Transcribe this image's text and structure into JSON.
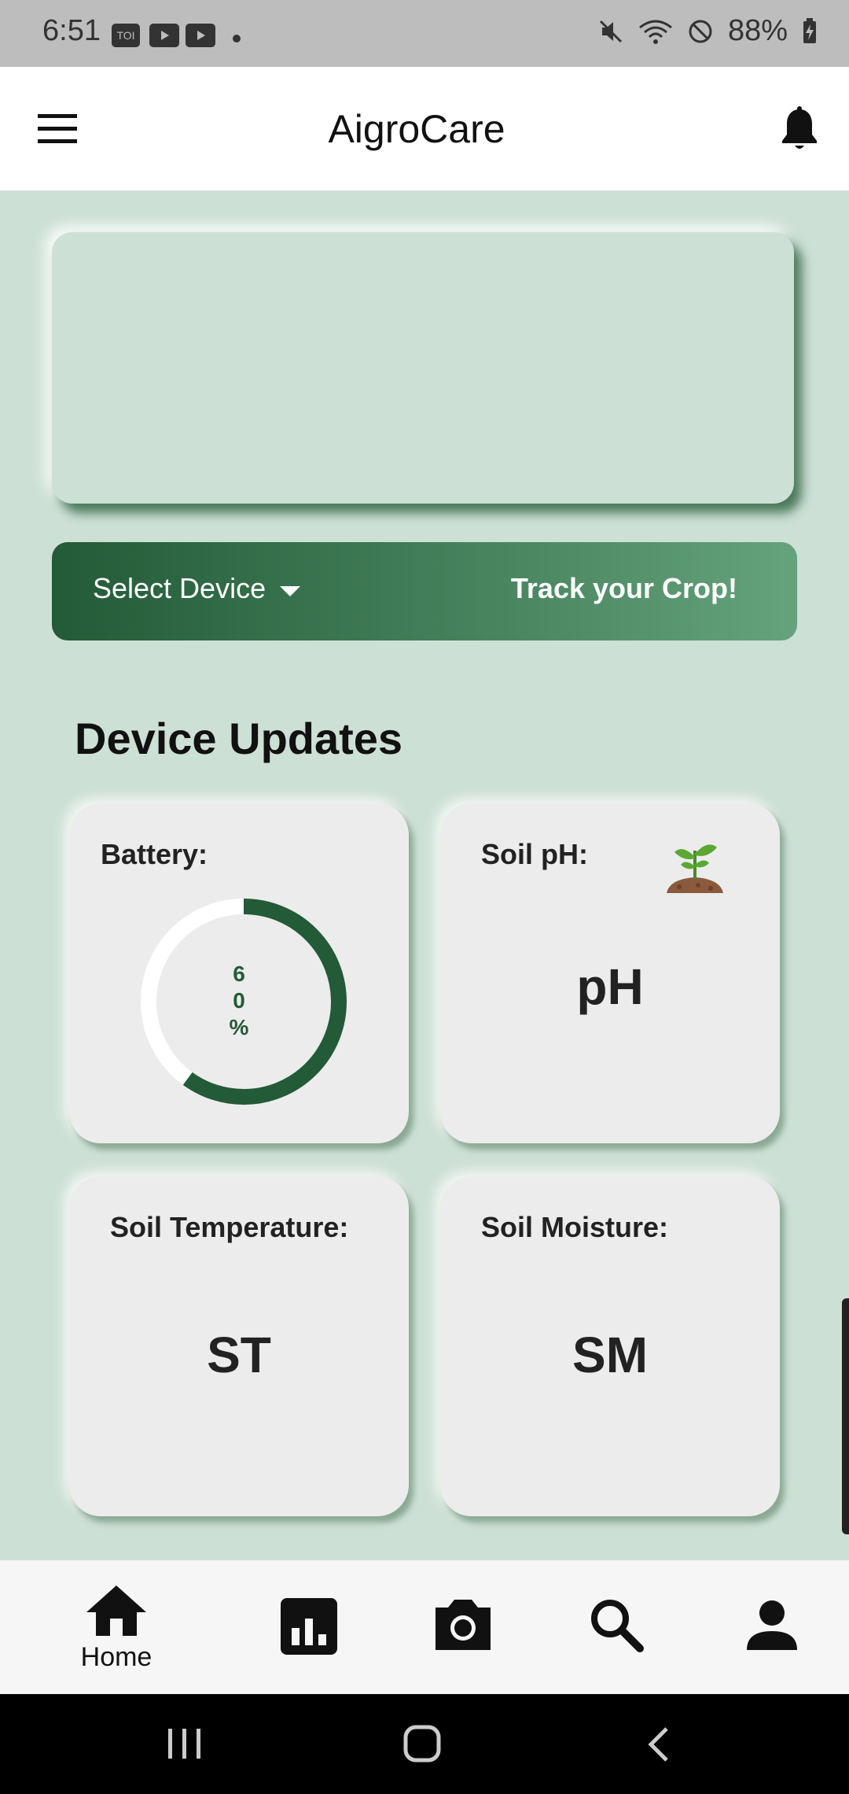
{
  "status_bar": {
    "time": "6:51",
    "battery": "88%",
    "app_icons": [
      "TOI",
      "youtube-icon",
      "youtube-icon"
    ]
  },
  "app_bar": {
    "title": "AigroCare",
    "menu_icon": "hamburger-menu-icon",
    "notification_icon": "bell-icon"
  },
  "device_bar": {
    "select_label": "Select Device",
    "track_label": "Track your Crop!"
  },
  "section": {
    "heading": "Device Updates"
  },
  "cards": {
    "battery": {
      "label": "Battery:",
      "value_chars": [
        "6",
        "0",
        "%"
      ],
      "percent": 60
    },
    "soil_ph": {
      "label": "Soil pH:",
      "value": "pH"
    },
    "soil_temperature": {
      "label": "Soil Temperature:",
      "value": "ST"
    },
    "soil_moisture": {
      "label": "Soil Moisture:",
      "value": "SM"
    }
  },
  "bottom_nav": {
    "items": [
      {
        "label": "Home",
        "icon": "home-icon"
      },
      {
        "label": "",
        "icon": "chart-icon"
      },
      {
        "label": "",
        "icon": "camera-icon"
      },
      {
        "label": "",
        "icon": "search-icon"
      },
      {
        "label": "",
        "icon": "profile-icon"
      }
    ]
  },
  "colors": {
    "accent_dark": "#235a37",
    "accent_light": "#65a37c",
    "background": "#cde0d6",
    "card": "#ececec"
  }
}
